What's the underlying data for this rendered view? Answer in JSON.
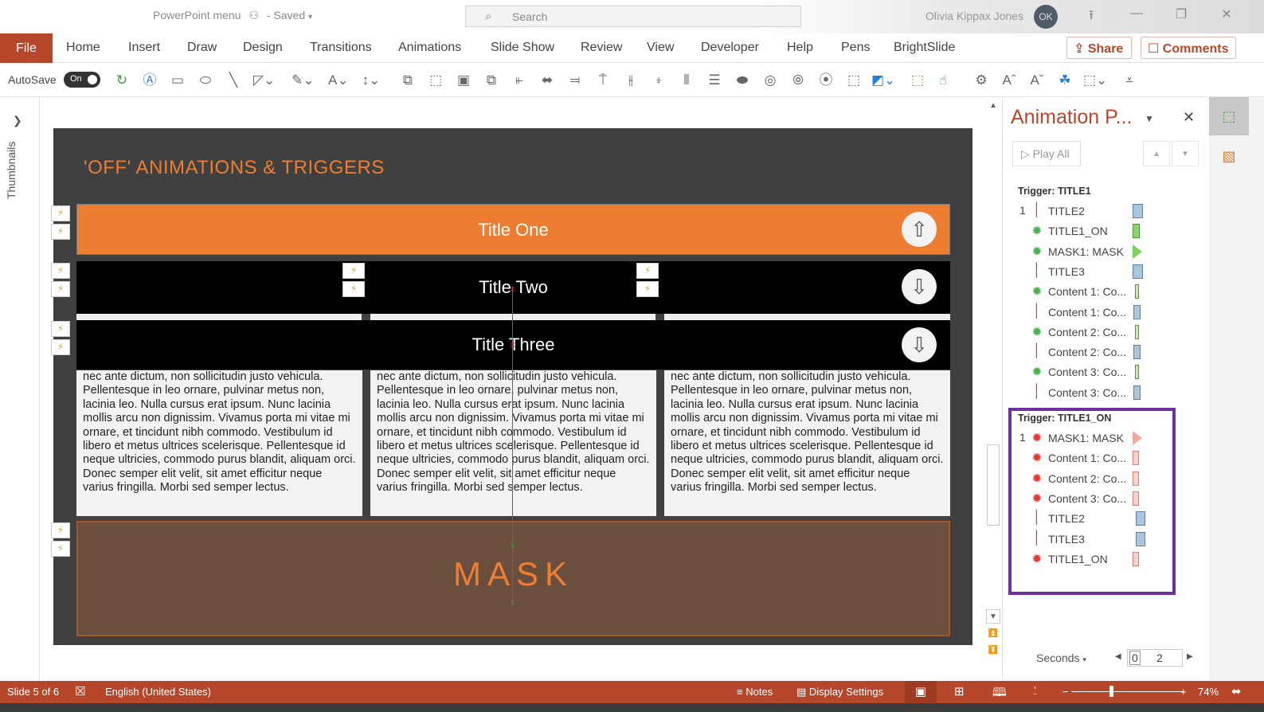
{
  "titlebar": {
    "doc_title": "PowerPoint menu",
    "saved_status": "- Saved",
    "search_placeholder": "Search",
    "user_name": "Olivia Kippax Jones",
    "user_initials": "OK"
  },
  "menu": {
    "file": "File",
    "items": [
      "Home",
      "Insert",
      "Draw",
      "Design",
      "Transitions",
      "Animations",
      "Slide Show",
      "Review",
      "View",
      "Developer",
      "Help",
      "Pens",
      "BrightSlide"
    ],
    "share": "Share",
    "comments": "Comments"
  },
  "toolbar": {
    "autosave_label": "AutoSave",
    "autosave_state": "On"
  },
  "left_panel": {
    "label": "Thumbnails"
  },
  "slide": {
    "title": "'OFF' ANIMATIONS & TRIGGERS",
    "band1": "Title One",
    "band2": "Title Two",
    "band3": "Title Three",
    "mask": "MASK",
    "column_text": [
      "nec ante dictum, non sollicitudin justo vehicula. Pellentesque in leo ornare, pulvinar metus non, lacinia leo. Nulla cursus erat ipsum. Nunc lacinia mollis arcu non dignissim. Vivamus porta mi vitae mi ornare, et tincidunt nibh commodo. Vestibulum id libero et metus ultrices scelerisque. Pellentesque id neque ultricies, commodo purus blandit, aliquam orci. Donec semper elit velit, sit amet efficitur neque varius fringilla. Morbi sed semper lectus.",
      "nec ante dictum, non sollicitudin justo vehicula. Pellentesque in leo ornare, pulvinar metus non, lacinia leo. Nulla cursus erat ipsum. Nunc lacinia mollis arcu non dignissim. Vivamus porta mi vitae mi ornare, et tincidunt nibh commodo. Vestibulum id libero et metus ultrices scelerisque. Pellentesque id neque ultricies, commodo purus blandit, aliquam orci. Donec semper elit velit, sit amet efficitur neque varius fringilla. Morbi sed semper lectus.",
      "nec ante dictum, non sollicitudin justo vehicula. Pellentesque in leo ornare, pulvinar metus non, lacinia leo. Nulla cursus erat ipsum. Nunc lacinia mollis arcu non dignissim. Vivamus porta mi vitae mi ornare, et tincidunt nibh commodo. Vestibulum id libero et metus ultrices scelerisque. Pellentesque id neque ultricies, commodo purus blandit, aliquam orci. Donec semper elit velit, sit amet efficitur neque varius fringilla. Morbi sed semper lectus."
    ],
    "colors": {
      "orange": "#ed7d31",
      "dark": "#404040",
      "mask_bg": "#6a4f3e"
    }
  },
  "animation_pane": {
    "title": "Animation P...",
    "play_all": "Play All",
    "groups": [
      {
        "trigger": "Trigger: TITLE1",
        "items": [
          {
            "num": "1",
            "type": "motion",
            "label": "TITLE2",
            "bar": "blue"
          },
          {
            "num": "",
            "type": "entrance",
            "label": "TITLE1_ON",
            "bar": "green"
          },
          {
            "num": "",
            "type": "entrance",
            "label": "MASK1: MASK",
            "bar": "green-tri"
          },
          {
            "num": "",
            "type": "motion",
            "label": "TITLE3",
            "bar": "blue"
          },
          {
            "num": "",
            "type": "entrance",
            "label": "Content 1: Co...",
            "bar": "green-thin"
          },
          {
            "num": "",
            "type": "motion",
            "label": "Content 1: Co...",
            "bar": "blue-thin"
          },
          {
            "num": "",
            "type": "entrance",
            "label": "Content 2: Co...",
            "bar": "green-thin"
          },
          {
            "num": "",
            "type": "motion",
            "label": "Content 2: Co...",
            "bar": "blue-thin"
          },
          {
            "num": "",
            "type": "entrance",
            "label": "Content 3: Co...",
            "bar": "green-thin"
          },
          {
            "num": "",
            "type": "motion",
            "label": "Content 3: Co...",
            "bar": "blue-thin"
          }
        ]
      },
      {
        "trigger": "Trigger: TITLE1_ON",
        "items": [
          {
            "num": "1",
            "type": "exit",
            "label": "MASK1: MASK",
            "bar": "red-tri"
          },
          {
            "num": "",
            "type": "exit",
            "label": "Content 1: Co...",
            "bar": "red"
          },
          {
            "num": "",
            "type": "exit",
            "label": "Content 2: Co...",
            "bar": "red"
          },
          {
            "num": "",
            "type": "exit",
            "label": "Content 3: Co...",
            "bar": "red"
          },
          {
            "num": "",
            "type": "motion-rev",
            "label": "TITLE2",
            "bar": "blue-late"
          },
          {
            "num": "",
            "type": "motion-rev",
            "label": "TITLE3",
            "bar": "blue-late"
          },
          {
            "num": "",
            "type": "exit",
            "label": "TITLE1_ON",
            "bar": "red"
          }
        ]
      }
    ],
    "seconds_label": "Seconds",
    "timescale": [
      "0",
      "2"
    ],
    "highlight_color": "#7030a0"
  },
  "status": {
    "slide": "Slide 5 of 6",
    "language": "English (United States)",
    "notes": "Notes",
    "display": "Display Settings",
    "zoom_percent": "74%",
    "zoom_value": 74
  }
}
